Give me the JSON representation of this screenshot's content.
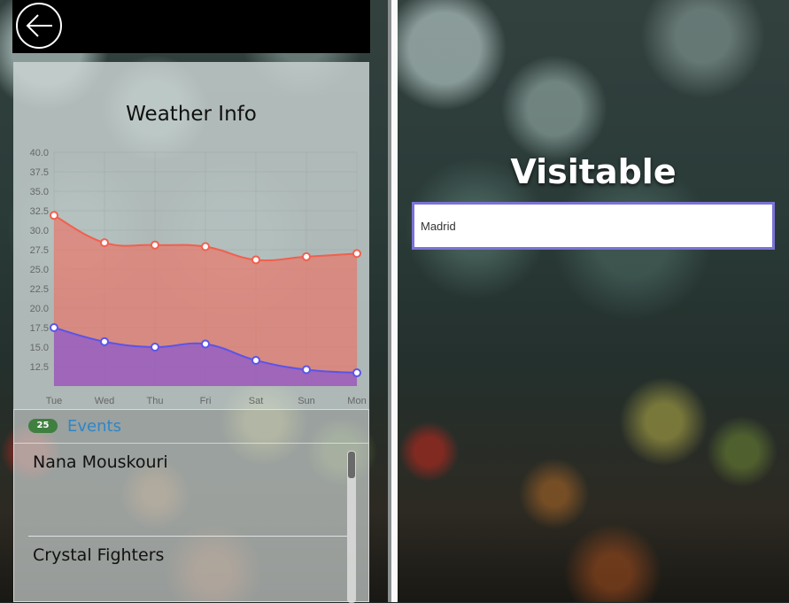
{
  "left_app": {
    "weather": {
      "title": "Weather Info"
    },
    "events": {
      "count_badge": "25",
      "title": "Events",
      "items": [
        {
          "name": "Nana Mouskouri"
        },
        {
          "name": "Crystal Fighters"
        }
      ]
    }
  },
  "right_app": {
    "brand": "Visitable",
    "search": {
      "value": "Madrid",
      "placeholder": ""
    }
  },
  "chart_data": {
    "type": "area",
    "title": "Weather Info",
    "categories": [
      "Tue",
      "Wed",
      "Thu",
      "Fri",
      "Sat",
      "Sun",
      "Mon"
    ],
    "ylim": [
      10,
      40
    ],
    "y_ticks": [
      "40.0",
      "37.5",
      "35.0",
      "32.5",
      "30.0",
      "27.5",
      "25.0",
      "22.5",
      "20.0",
      "17.5",
      "15.0",
      "12.5"
    ],
    "grid": true,
    "series": [
      {
        "values": [
          31.9,
          28.4,
          28.1,
          27.9,
          26.2,
          26.6,
          27.0
        ],
        "color": "#f0604e",
        "fill": "rgba(240,110,95,0.62)"
      },
      {
        "values": [
          17.5,
          15.7,
          15.0,
          15.4,
          13.3,
          12.1,
          11.7
        ],
        "color": "#5b54e8",
        "fill": "rgba(125,80,220,0.62)"
      }
    ]
  },
  "colors": {
    "accent_border": "#7b73d6",
    "badge": "#3f7f3f",
    "events_title": "#2f86c7"
  }
}
